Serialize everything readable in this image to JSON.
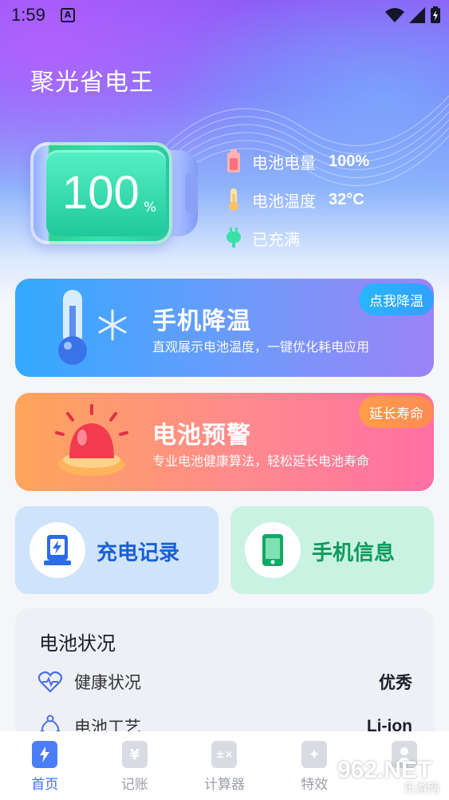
{
  "status_bar": {
    "time": "1:59",
    "notification_icon": "a-letter-icon",
    "icons": [
      "wifi-icon",
      "cell-signal-icon",
      "battery-charging-icon"
    ]
  },
  "app": {
    "title": "聚光省电王"
  },
  "battery": {
    "level": "100",
    "unit": "%",
    "level_fraction": 1.0,
    "info": [
      {
        "icon": "battery-icon",
        "label": "电池电量",
        "value": "100%"
      },
      {
        "icon": "thermometer-icon",
        "label": "电池温度",
        "value": "32°C"
      },
      {
        "icon": "plug-icon",
        "label": "已充满",
        "value": ""
      }
    ]
  },
  "cards": {
    "cool": {
      "title": "手机降温",
      "subtitle": "直观展示电池温度，一键优化耗电应用",
      "badge": "点我降温",
      "icon": "thermometer-snowflake-icon"
    },
    "warn": {
      "title": "电池预警",
      "subtitle": "专业电池健康算法，轻松延长电池寿命",
      "badge": "延长寿命",
      "icon": "alarm-light-icon"
    }
  },
  "tiles": {
    "charge": {
      "label": "充电记录",
      "icon": "charging-station-icon"
    },
    "phone": {
      "label": "手机信息",
      "icon": "smartphone-icon"
    }
  },
  "battery_status": {
    "title": "电池状况",
    "rows": [
      {
        "icon": "heart-pulse-icon",
        "label": "健康状况",
        "value": "优秀"
      },
      {
        "icon": "molecule-icon",
        "label": "电池工艺",
        "value": "Li-ion"
      }
    ]
  },
  "bottom_nav": {
    "items": [
      {
        "label": "首页",
        "icon": "home-lightning-icon",
        "active": true
      },
      {
        "label": "记账",
        "icon": "yuan-receipt-icon",
        "active": false
      },
      {
        "label": "计算器",
        "icon": "calculator-icon",
        "active": false
      },
      {
        "label": "特效",
        "icon": "sparkle-card-icon",
        "active": false
      },
      {
        "label": "",
        "icon": "user-icon",
        "active": false
      }
    ]
  },
  "watermark": {
    "text": "962.NET",
    "sub": "乐游网"
  },
  "colors": {
    "accent_blue": "#3d6ff0",
    "cool_card": "#33a9ff",
    "warn_card": "#ff8a8e",
    "battery_green": "#1fc99a"
  }
}
